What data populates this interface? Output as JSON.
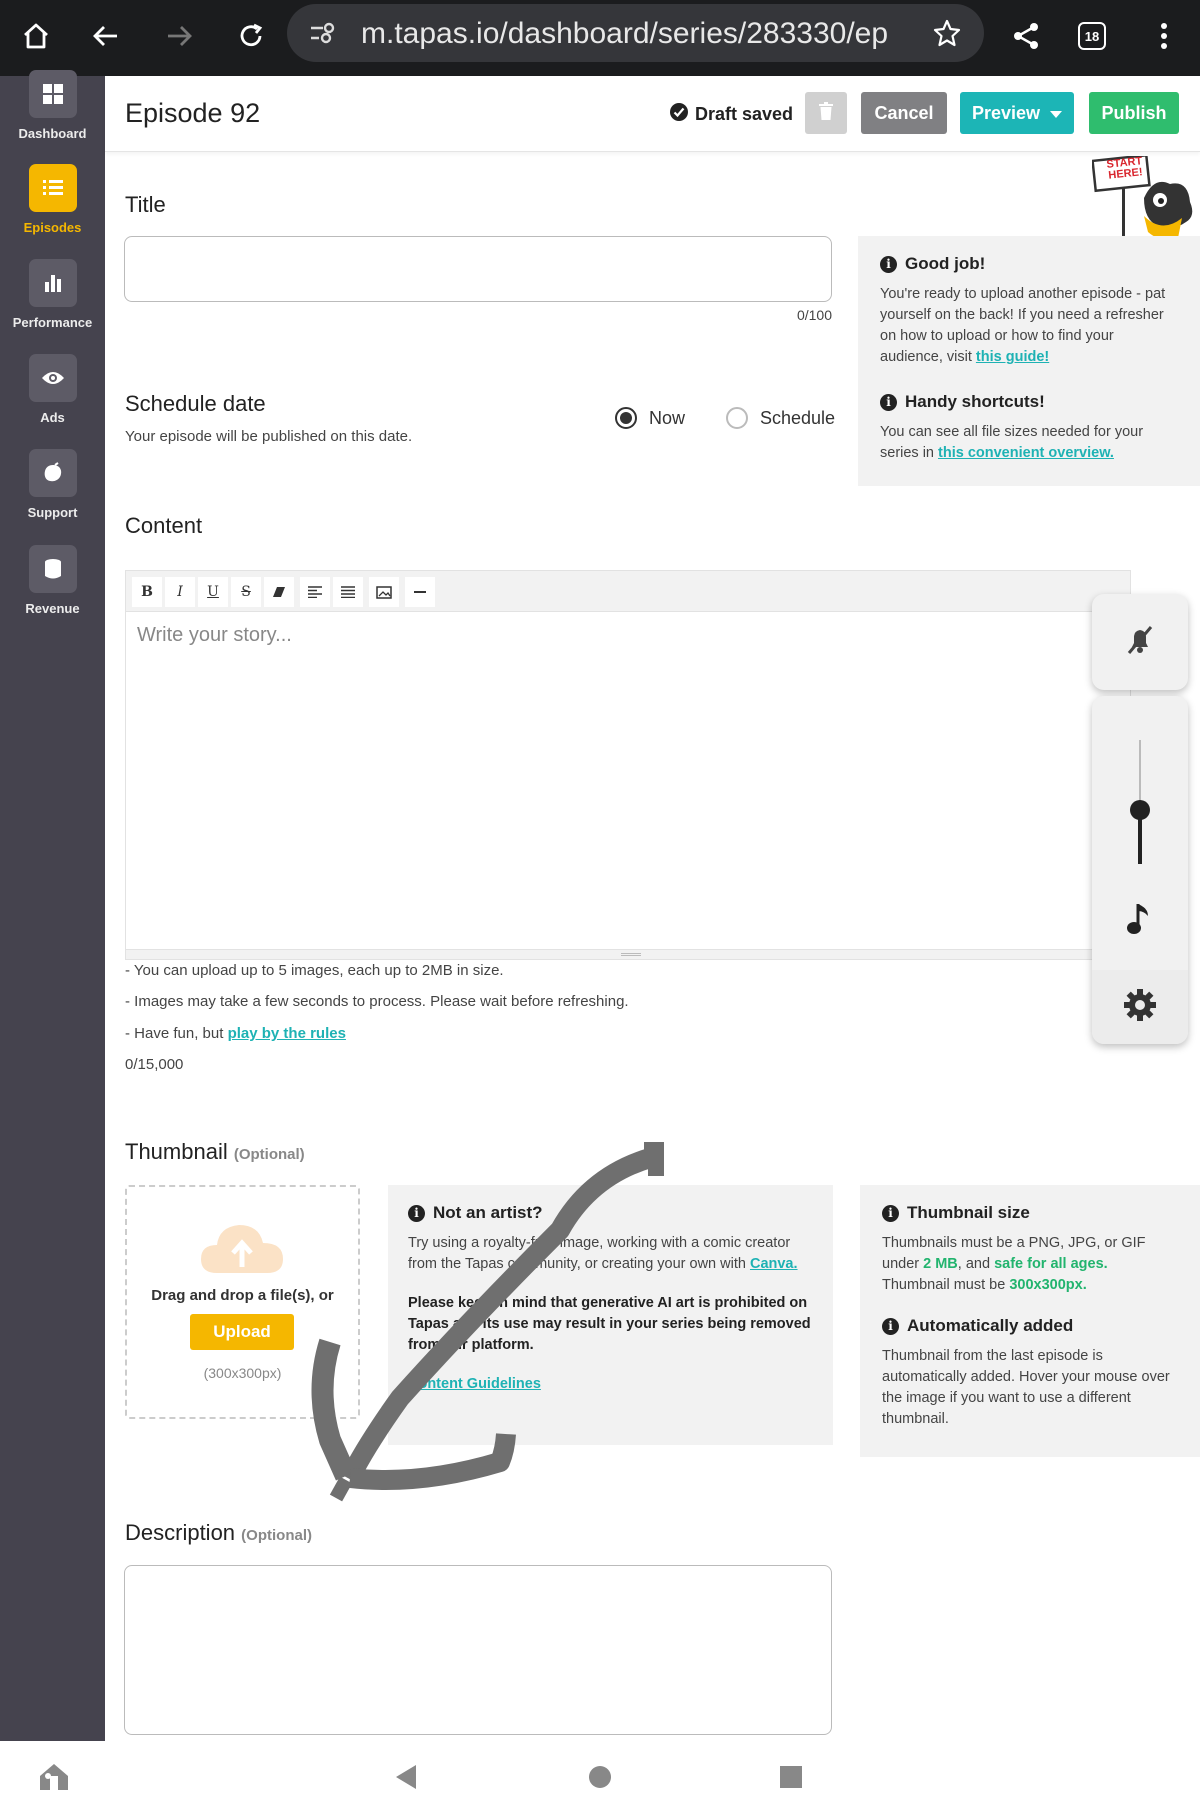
{
  "browser": {
    "url": "m.tapas.io/dashboard/series/283330/ep",
    "tab_count": "18"
  },
  "sidebar": {
    "items": [
      {
        "label": "Dashboard",
        "icon": "grid-icon"
      },
      {
        "label": "Episodes",
        "icon": "list-icon"
      },
      {
        "label": "Performance",
        "icon": "bar-chart-icon"
      },
      {
        "label": "Ads",
        "icon": "eye-icon"
      },
      {
        "label": "Support",
        "icon": "support-icon"
      },
      {
        "label": "Revenue",
        "icon": "coins-icon"
      }
    ],
    "active_item": "Episodes",
    "colors": {
      "background": "#45434e",
      "active": "#f5b700"
    }
  },
  "header": {
    "episode_title": "Episode 92",
    "draft_status": "Draft saved",
    "cancel_label": "Cancel",
    "preview_label": "Preview",
    "publish_label": "Publish",
    "colors": {
      "cancel": "#808083",
      "preview": "#1cb5b6",
      "publish": "#2fbd6e"
    }
  },
  "mascot": {
    "sign_text": "START HERE!"
  },
  "title_section": {
    "label": "Title",
    "value": "",
    "counter": "0/100"
  },
  "schedule": {
    "label": "Schedule date",
    "hint": "Your episode will be published on this date.",
    "options": [
      "Now",
      "Schedule"
    ],
    "selected": "Now"
  },
  "tips": {
    "good_job_title": "Good job!",
    "good_job_text": "You're ready to upload another episode - pat yourself on the back! If you need a refresher on how to upload or how to find your audience, visit ",
    "good_job_link": "this guide!",
    "shortcuts_title": "Handy shortcuts!",
    "shortcuts_text": "You can see all file sizes needed for your series in ",
    "shortcuts_link": "this convenient overview."
  },
  "content": {
    "label": "Content",
    "placeholder": "Write your story...",
    "notes": [
      "- You can upload up to 5 images, each up to 2MB in size.",
      "- Images may take a few seconds to process. Please wait before refreshing."
    ],
    "rules_prefix": "- Have fun, but ",
    "rules_link": "play by the rules",
    "counter": "0/15,000"
  },
  "thumbnail": {
    "label": "Thumbnail",
    "optional": "(Optional)",
    "drop_text": "Drag and drop a file(s), or",
    "upload_label": "Upload",
    "size_hint": "(300x300px)",
    "artist_title": "Not an artist?",
    "artist_text": "Try using a royalty-free image, working with a comic creator from the Tapas community, or creating your own with ",
    "artist_link": "Canva.",
    "ai_warning": "Please keep in mind that generative AI art is prohibited on Tapas and its use may result in your series being removed from our platform.",
    "guidelines_link": "Content Guidelines",
    "size_title": "Thumbnail size",
    "size_text_1": "Thumbnails must be a PNG, JPG, or GIF under ",
    "size_hl_1": "2 MB",
    "size_text_2": ", and ",
    "size_hl_2": "safe for all ages.",
    "size_text_3": "Thumbnail must be ",
    "size_hl_3": "300x300px.",
    "auto_title": "Automatically added",
    "auto_text": "Thumbnail from the last episode is automatically added. Hover your mouse over the image if you want to use a different thumbnail."
  },
  "description": {
    "label": "Description",
    "optional": "(Optional)",
    "value": ""
  }
}
